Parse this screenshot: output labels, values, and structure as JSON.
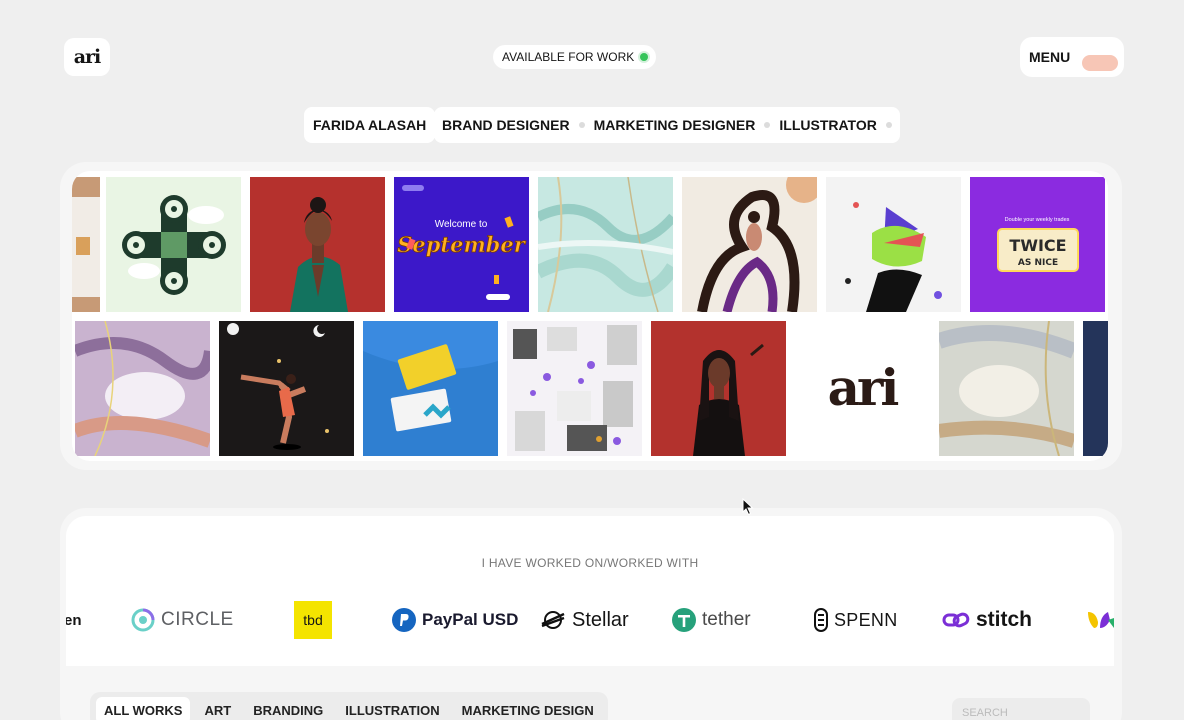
{
  "header": {
    "logo_text": "ari",
    "availability": "AVAILABLE FOR WORK",
    "menu_label": "MENU"
  },
  "intro": {
    "name": "FARIDA ALASAH",
    "roles": [
      "BRAND DESIGNER",
      "MARKETING DESIGNER",
      "ILLUSTRATOR"
    ]
  },
  "gallery": {
    "tile_texts": {
      "welcome": "Welcome to",
      "september": "September",
      "twice_top": "Double your weekly trades",
      "twice": "TWICE",
      "as_nice": "AS NICE",
      "logo": "ari"
    }
  },
  "brands": {
    "heading": "I HAVE WORKED ON/WORKED WITH",
    "items": [
      {
        "label": "en",
        "icon": "partial-logo-icon"
      },
      {
        "label": "CIRCLE",
        "icon": "circle-logo-icon"
      },
      {
        "label": "tbd",
        "icon": "tbd-logo-icon"
      },
      {
        "label": "PayPal USD",
        "icon": "paypal-logo-icon"
      },
      {
        "label": "Stellar",
        "icon": "stellar-logo-icon"
      },
      {
        "label": "tether",
        "icon": "tether-logo-icon"
      },
      {
        "label": "SPENN",
        "icon": "spenn-logo-icon"
      },
      {
        "label": "stitch",
        "icon": "stitch-logo-icon"
      }
    ],
    "colors": {
      "circle": "#6e6f72",
      "tbd": "#f4e400",
      "paypal": "#1565c0",
      "tether": "#26a17b",
      "stitch": "#7b2fd6"
    }
  },
  "filters": {
    "items": [
      "ALL WORKS",
      "ART",
      "BRANDING",
      "ILLUSTRATION",
      "MARKETING DESIGN"
    ],
    "active": "ALL WORKS"
  },
  "search": {
    "placeholder": "SEARCH"
  }
}
